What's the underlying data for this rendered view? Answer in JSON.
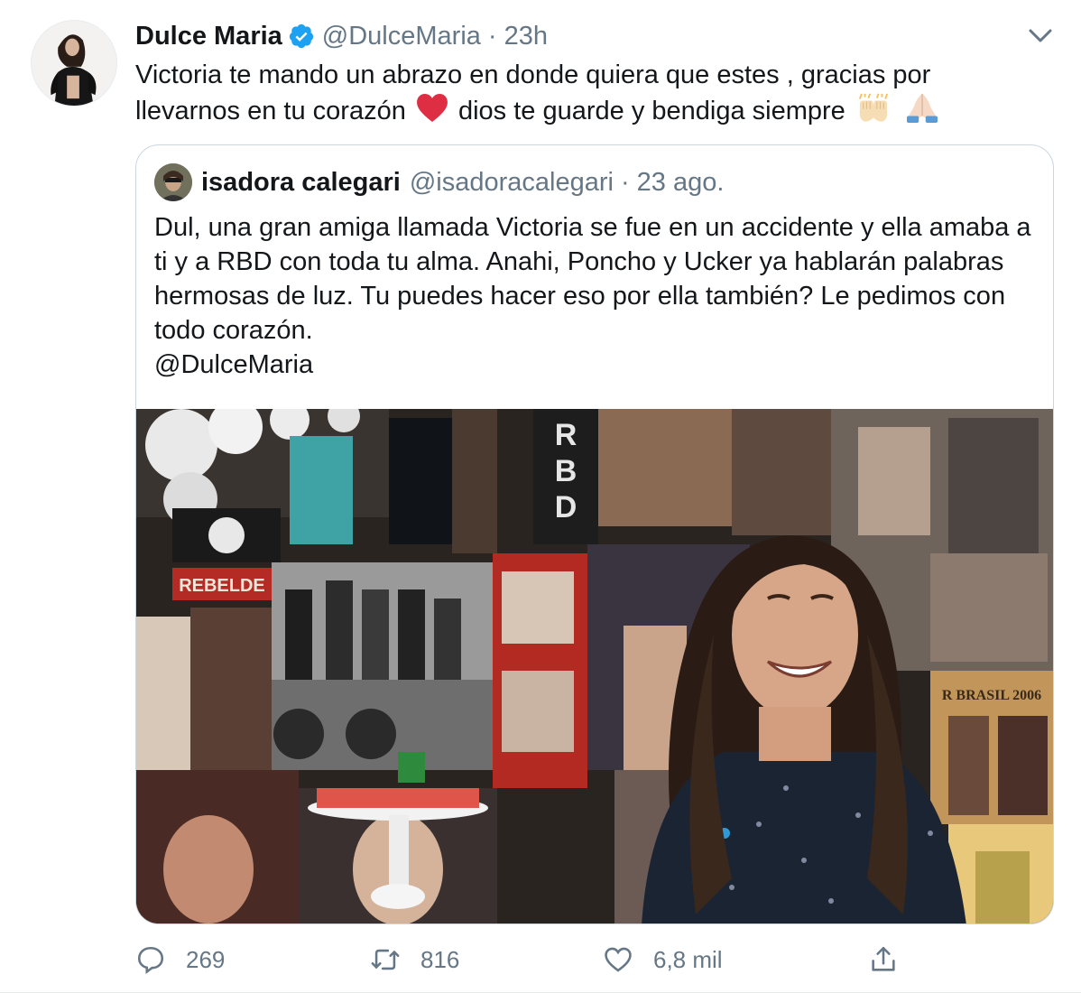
{
  "tweet": {
    "author_name": "Dulce Maria",
    "handle": "@DulceMaria",
    "separator": "·",
    "time": "23h",
    "text": "Victoria te mando un abrazo en donde quiera que estes , gracias por llevarnos en tu corazón",
    "text_after_heart": "dios te guarde y bendiga siempre",
    "icons": [
      "verified-badge",
      "more-options-chevron",
      "red-heart-emoji",
      "raising-hands-emoji",
      "folded-hands-emoji"
    ]
  },
  "quote": {
    "author_name": "isadora calegari",
    "handle": "@isadoracalegari",
    "separator": "·",
    "time": "23 ago.",
    "text": "Dul, una gran amiga llamada Victoria se fue en un accidente y ella amaba a ti y a RBD con toda tu alma. Anahi, Poncho y Ucker ya hablarán palabras hermosas de luz. Tu puedes hacer eso por ella también? Le pedimos con todo corazón.",
    "mention": "@DulceMaria",
    "photo_text": {
      "rbd_vertical": "RBD",
      "rebelde": "REBELDE",
      "brasil": "R BRASIL 2006"
    }
  },
  "actions": {
    "reply_count": "269",
    "retweet_count": "816",
    "like_count": "6,8 mil"
  },
  "colors": {
    "verified": "#1da1f2",
    "secondary_text": "#657786",
    "border": "#ccd6dd",
    "heart": "#dd2e44"
  }
}
